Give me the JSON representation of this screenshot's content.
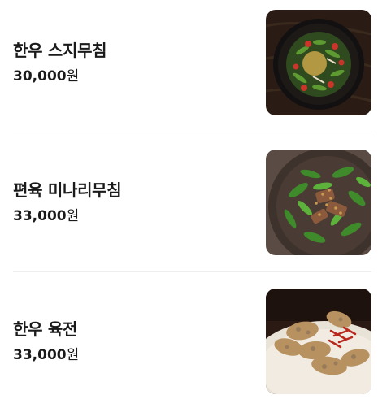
{
  "menu": {
    "items": [
      {
        "name": "한우 스지무침",
        "price": "30,000",
        "currency": "원",
        "image_icon": "beef-tendon-salad-photo"
      },
      {
        "name": "편육 미나리무침",
        "price": "33,000",
        "currency": "원",
        "image_icon": "pressed-pork-minari-salad-photo"
      },
      {
        "name": "한우 육전",
        "price": "33,000",
        "currency": "원",
        "image_icon": "beef-jeon-pancake-photo"
      }
    ]
  }
}
